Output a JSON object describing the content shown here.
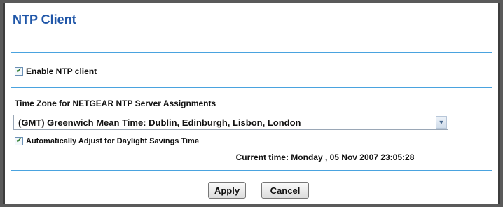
{
  "page": {
    "title": "NTP Client"
  },
  "enable_ntp": {
    "label": "Enable NTP client",
    "checked": true
  },
  "timezone": {
    "label": "Time Zone for NETGEAR NTP Server Assignments",
    "selected": "(GMT) Greenwich Mean Time: Dublin, Edinburgh, Lisbon, London"
  },
  "dst": {
    "label": "Automatically Adjust for Daylight Savings Time",
    "checked": true
  },
  "current_time": {
    "text": "Current time: Monday , 05 Nov 2007 23:05:28"
  },
  "buttons": {
    "apply": "Apply",
    "cancel": "Cancel"
  },
  "colors": {
    "title": "#1f56a8",
    "rule": "#4aa3df"
  },
  "icons": {
    "checkbox_check": "✔",
    "dropdown": "▼"
  }
}
